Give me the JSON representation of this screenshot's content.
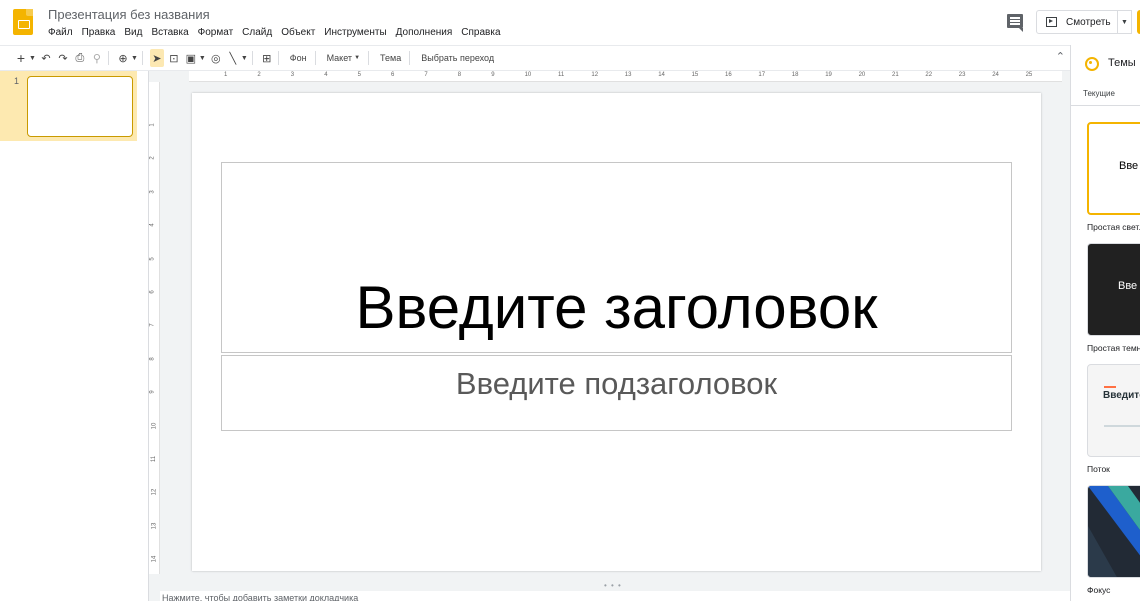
{
  "header": {
    "doc_title": "Презентация без названия",
    "menu": [
      "Файл",
      "Правка",
      "Вид",
      "Вставка",
      "Формат",
      "Слайд",
      "Объект",
      "Инструменты",
      "Дополнения",
      "Справка"
    ],
    "present_label": "Смотреть"
  },
  "toolbar": {
    "background_label": "Фон",
    "layout_label": "Макет",
    "theme_label": "Тема",
    "transition_label": "Выбрать переход"
  },
  "filmstrip": {
    "slides": [
      {
        "number": "1"
      }
    ]
  },
  "ruler": {
    "h_ticks": [
      "1",
      "2",
      "3",
      "4",
      "5",
      "6",
      "7",
      "8",
      "9",
      "10",
      "11",
      "12",
      "13",
      "14",
      "15",
      "16",
      "17",
      "18",
      "19",
      "20",
      "21",
      "22",
      "23",
      "24",
      "25"
    ],
    "v_ticks": [
      "1",
      "2",
      "3",
      "4",
      "5",
      "6",
      "7",
      "8",
      "9",
      "10",
      "11",
      "12",
      "13",
      "14"
    ]
  },
  "slide": {
    "title_placeholder": "Введите заголовок",
    "subtitle_placeholder": "Введите подзаголовок"
  },
  "notes": {
    "placeholder": "Нажмите, чтобы добавить заметки докладчика"
  },
  "themes_panel": {
    "title": "Темы",
    "current_label": "Текущие",
    "themes": [
      {
        "name": "Простая светлая",
        "preview_text": "Вве",
        "bg": "#ffffff",
        "text_color": "#000000"
      },
      {
        "name": "Простая темная",
        "preview_text": "Вве",
        "bg": "#212121",
        "text_color": "#ffffff"
      },
      {
        "name": "Поток",
        "preview_text": "Введите",
        "bg": "#f5f5f5",
        "text_color": "#263238"
      },
      {
        "name": "Фокус",
        "preview_text": "",
        "bg": "#222a35",
        "text_color": "#ffffff"
      }
    ]
  },
  "colors": {
    "accent": "#f4b400",
    "selection": "#fde9b0"
  }
}
